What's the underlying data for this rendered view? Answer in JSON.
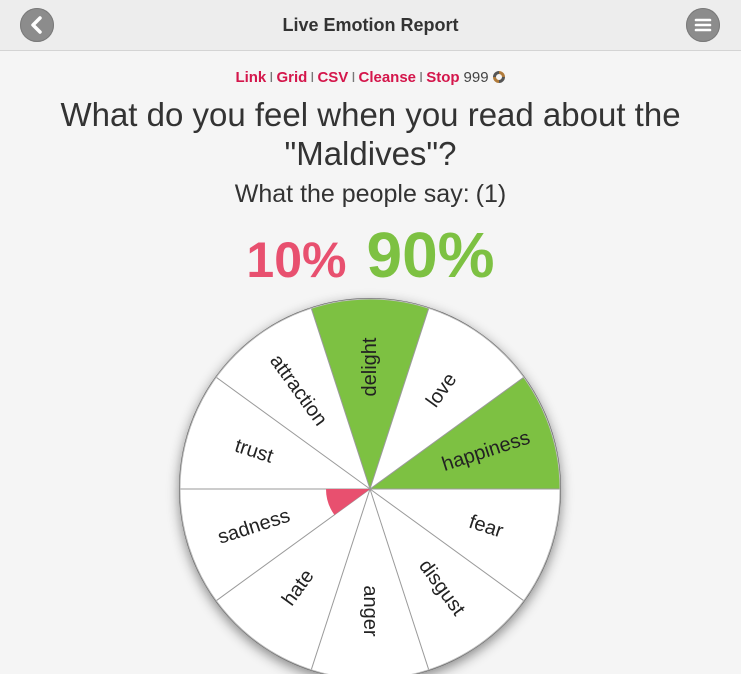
{
  "header": {
    "title": "Live Emotion Report",
    "back_icon": "chevron-left-icon",
    "menu_icon": "hamburger-menu-icon"
  },
  "links": {
    "items": [
      "Link",
      "Grid",
      "CSV",
      "Cleanse",
      "Stop"
    ],
    "separator": "I",
    "counter": "999",
    "spinner_icon": "spinner-icon"
  },
  "question": {
    "line1": "What do you feel when you read about the",
    "line2": "\"Maldives\"?"
  },
  "summary": {
    "label": "What the people say:",
    "count": "(1)",
    "negative_pct": "10%",
    "positive_pct": "90%"
  },
  "wheel": {
    "emotions": [
      {
        "label": "delight",
        "highlighted": true
      },
      {
        "label": "love",
        "highlighted": false
      },
      {
        "label": "happiness",
        "highlighted": true
      },
      {
        "label": "fear",
        "highlighted": false
      },
      {
        "label": "disgust",
        "highlighted": false
      },
      {
        "label": "anger",
        "highlighted": false
      },
      {
        "label": "hate",
        "highlighted": false
      },
      {
        "label": "sadness",
        "highlighted": false
      },
      {
        "label": "trust",
        "highlighted": false
      },
      {
        "label": "attraction",
        "highlighted": false
      }
    ],
    "negative_share": 0.1
  },
  "colors": {
    "positive": "#7dc142",
    "negative": "#e8506f",
    "link": "#d4164b",
    "slice": "#ffffff",
    "divider": "#9a9a9a"
  }
}
